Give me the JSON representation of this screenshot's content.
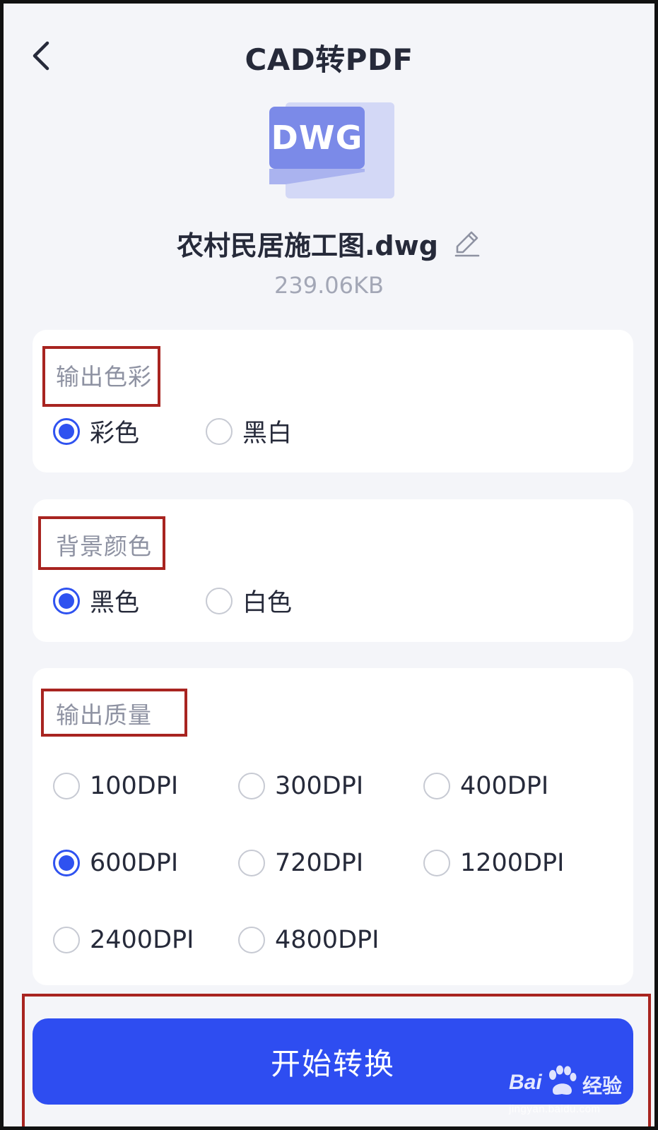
{
  "header": {
    "title": "CAD转PDF",
    "back_icon": "chevron-left-icon"
  },
  "file": {
    "type_badge": "DWG",
    "name": "农村民居施工图.dwg",
    "size": "239.06KB",
    "edit_icon": "pencil-icon"
  },
  "output_color": {
    "label": "输出色彩",
    "options": [
      {
        "label": "彩色",
        "checked": true
      },
      {
        "label": "黑白",
        "checked": false
      }
    ]
  },
  "background_color": {
    "label": "背景颜色",
    "options": [
      {
        "label": "黑色",
        "checked": true
      },
      {
        "label": "白色",
        "checked": false
      }
    ]
  },
  "output_quality": {
    "label": "输出质量",
    "options": [
      {
        "label": "100DPI",
        "checked": false
      },
      {
        "label": "300DPI",
        "checked": false
      },
      {
        "label": "400DPI",
        "checked": false
      },
      {
        "label": "600DPI",
        "checked": true
      },
      {
        "label": "720DPI",
        "checked": false
      },
      {
        "label": "1200DPI",
        "checked": false
      },
      {
        "label": "2400DPI",
        "checked": false
      },
      {
        "label": "4800DPI",
        "checked": false
      }
    ]
  },
  "actions": {
    "start_label": "开始转换"
  },
  "watermark": {
    "brand": "Bai",
    "brand_suffix": "经验",
    "url": "jingyan.baidu.com"
  },
  "colors": {
    "accent": "#2f52f0",
    "button": "#2e4df1",
    "annotation": "#a82420",
    "background": "#f4f5f9"
  }
}
